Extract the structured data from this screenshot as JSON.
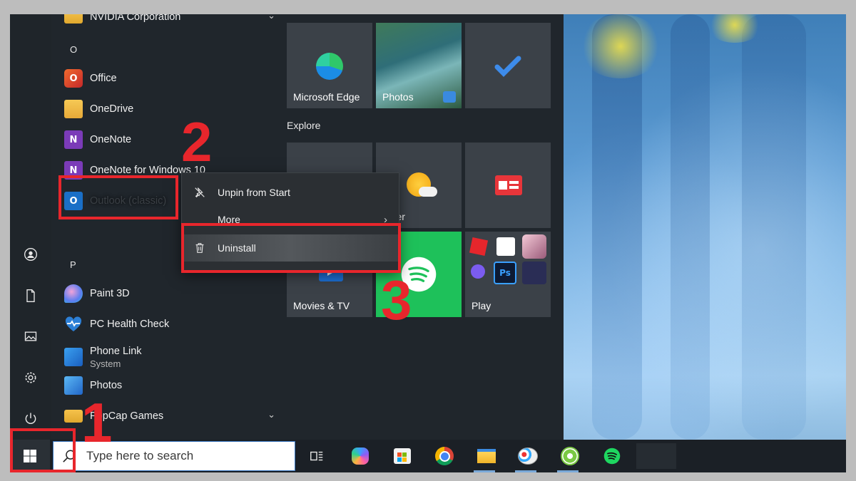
{
  "start_menu": {
    "apps": [
      {
        "name": "NVIDIA Corporation",
        "icon": "folder-icon",
        "expandable": true
      },
      {
        "letter": "O"
      },
      {
        "name": "Office",
        "icon": "office-icon"
      },
      {
        "name": "OneDrive",
        "icon": "onedrive-icon"
      },
      {
        "name": "OneNote",
        "icon": "onenote-icon"
      },
      {
        "name": "OneNote for Windows 10",
        "icon": "onenote-icon"
      },
      {
        "name": "Outlook (classic)",
        "icon": "outlook-icon"
      },
      {
        "letter": "P"
      },
      {
        "name": "Paint 3D",
        "icon": "paint3d-icon"
      },
      {
        "name": "PC Health Check",
        "icon": "pc-health-icon"
      },
      {
        "name": "Phone Link",
        "subtitle": "System",
        "icon": "phone-link-icon"
      },
      {
        "name": "Photos",
        "icon": "photos-icon"
      },
      {
        "name": "PopCap Games",
        "icon": "folder-icon",
        "expandable": true
      }
    ],
    "rail_icons": [
      "user-icon",
      "document-icon",
      "pictures-icon",
      "settings-icon",
      "power-icon"
    ],
    "tiles": {
      "top": [
        {
          "label": "Microsoft Edge",
          "icon": "edge-icon"
        },
        {
          "label": "Photos",
          "icon": "photos-tile-icon"
        },
        {
          "label": "",
          "icon": "todo-check-icon"
        }
      ],
      "group_label": "Explore",
      "row2": [
        {
          "label": "",
          "icon": "store-icon"
        },
        {
          "label": "ather",
          "icon": "weather-icon"
        },
        {
          "label": "",
          "icon": "news-icon"
        }
      ],
      "row3": [
        {
          "label": "Movies & TV",
          "icon": "movies-icon"
        },
        {
          "label": "",
          "icon": "spotify-icon"
        },
        {
          "label": "Play",
          "icon": "play-folder-icon"
        }
      ]
    }
  },
  "context_menu": {
    "items": [
      {
        "label": "Unpin from Start",
        "icon": "unpin-icon"
      },
      {
        "label": "More",
        "icon": "",
        "submenu": true
      },
      {
        "label": "Uninstall",
        "icon": "trash-icon",
        "highlighted": true
      }
    ]
  },
  "taskbar": {
    "search_placeholder": "Type here to search",
    "pinned": [
      "task-view-icon",
      "copilot-icon",
      "store-icon",
      "chrome-icon",
      "file-explorer-icon",
      "paint-icon",
      "app-icon",
      "spotify-icon"
    ]
  },
  "annotations": {
    "step1": "1",
    "step2": "2",
    "step3": "3",
    "color": "#e8262c"
  }
}
